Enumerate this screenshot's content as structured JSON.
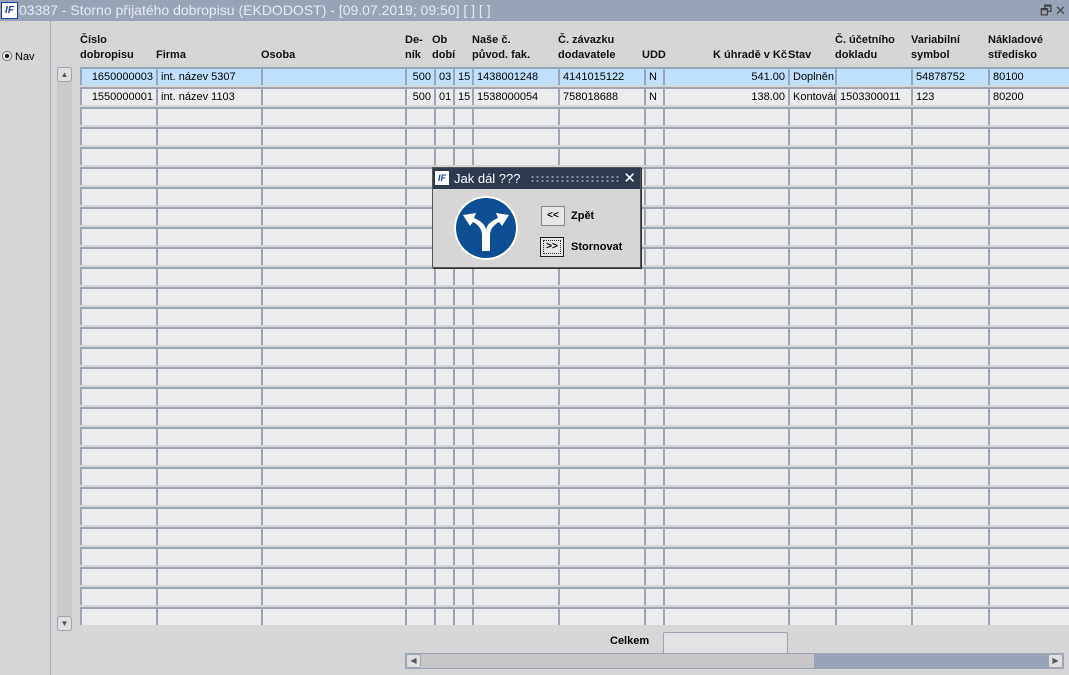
{
  "window": {
    "title": "03387 - Storno přijatého dobropisu (EKDODOST) - [09.07.2019; 09:50]  [ ]  [ ]",
    "logo": "IF",
    "restore_icon": "restore-icon",
    "close_icon": "close-icon"
  },
  "nav": {
    "label": "Nav",
    "selected": true
  },
  "columns": [
    {
      "l1": "Číslo",
      "l2": "dobropisu"
    },
    {
      "l1": "",
      "l2": "Firma"
    },
    {
      "l1": "",
      "l2": "Osoba"
    },
    {
      "l1": "De-",
      "l2": "ník"
    },
    {
      "l1": "Ob",
      "l2": "dobí"
    },
    {
      "l1": "",
      "l2": ""
    },
    {
      "l1": "Naše č.",
      "l2": "původ. fak."
    },
    {
      "l1": "Č. závazku",
      "l2": "dodavatele"
    },
    {
      "l1": "",
      "l2": "UDD"
    },
    {
      "l1": "",
      "l2": "K úhradě v Kč"
    },
    {
      "l1": "",
      "l2": "Stav"
    },
    {
      "l1": "Č. účetního",
      "l2": "dokladu"
    },
    {
      "l1": "Variabilní",
      "l2": "symbol"
    },
    {
      "l1": "Nákladové",
      "l2": "středisko"
    }
  ],
  "rows": [
    [
      "1650000003",
      "int. název 5307",
      "",
      "500",
      "03",
      "15",
      "1438001248",
      "4141015122",
      "N",
      "541.00",
      "Doplněn",
      "",
      "54878752",
      "80100"
    ],
    [
      "1550000001",
      "int. název 1103",
      "",
      "500",
      "01",
      "15",
      "1538000054",
      "758018688",
      "N",
      "138.00",
      "Kontování",
      "1503300011",
      "123",
      "80200"
    ]
  ],
  "selected_row": 0,
  "footer": {
    "total_label": "Celkem",
    "total_value": ""
  },
  "dialog": {
    "title": "Jak dál ???",
    "logo": "IF",
    "icon": "road-fork-sign-icon",
    "buttons": [
      {
        "symbol": "<<",
        "label": "Zpět"
      },
      {
        "symbol": ">>",
        "label": "Stornovat"
      }
    ]
  }
}
